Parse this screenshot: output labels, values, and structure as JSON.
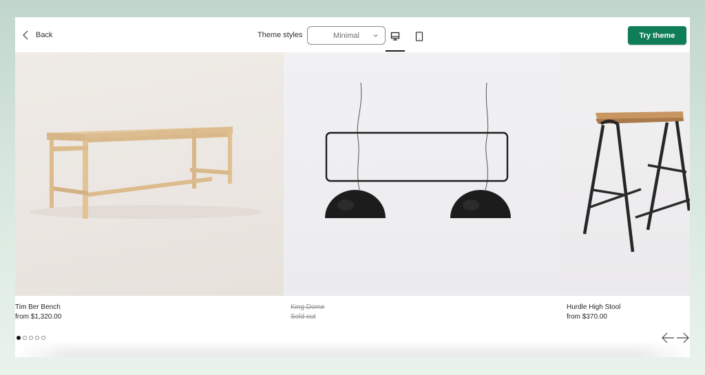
{
  "topbar": {
    "back_label": "Back",
    "theme_styles_label": "Theme styles",
    "theme_style_selected": "Minimal",
    "preview_devices": [
      {
        "name": "desktop",
        "icon": "desktop-icon",
        "active": true
      },
      {
        "name": "mobile",
        "icon": "mobile-icon",
        "active": false
      }
    ],
    "try_theme_label": "Try theme"
  },
  "colors": {
    "accent": "#0f7d57",
    "background": "#c1d6cb",
    "text": "#1f1f1f",
    "muted": "#8f8f8f"
  },
  "products": [
    {
      "name": "Tim Ber Bench",
      "price": "from $1,320.00",
      "sold_out": false
    },
    {
      "name": "King Dome",
      "price": "Sold out",
      "sold_out": true
    },
    {
      "name": "Hurdle High Stool",
      "price": "from $370.00",
      "sold_out": false
    }
  ],
  "carousel": {
    "page_count": 5,
    "active_index": 0,
    "prev_icon": "arrow-left-icon",
    "next_icon": "arrow-right-icon"
  }
}
